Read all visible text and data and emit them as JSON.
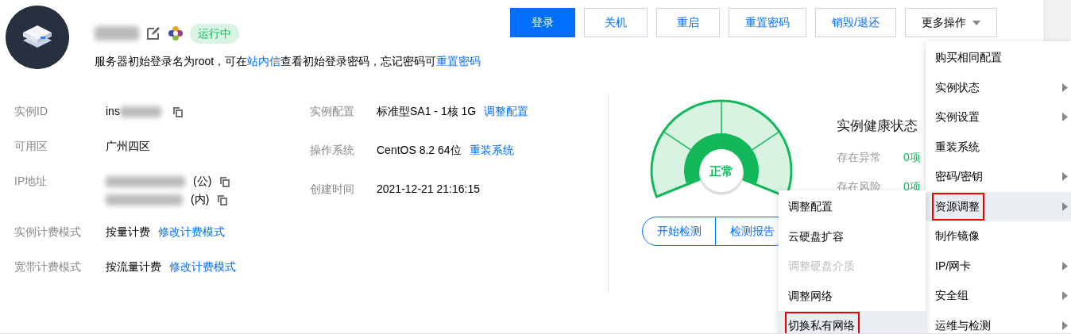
{
  "header": {
    "status": "运行中",
    "notice": [
      {
        "text": "服务器初始登录名为root，可在",
        "link": false
      },
      {
        "text": "站内信",
        "link": true
      },
      {
        "text": "查看初始登录密码，忘记密码可",
        "link": false
      },
      {
        "text": "重置密码",
        "link": true
      }
    ]
  },
  "actions": [
    {
      "label": "登录",
      "primary": true,
      "caret": false
    },
    {
      "label": "关机",
      "primary": false,
      "caret": false
    },
    {
      "label": "重启",
      "primary": false,
      "caret": false
    },
    {
      "label": "重置密码",
      "primary": false,
      "caret": false
    },
    {
      "label": "销毁/退还",
      "primary": false,
      "caret": false
    },
    {
      "label": "更多操作",
      "primary": false,
      "caret": true
    }
  ],
  "details_left": [
    {
      "label": "实例ID",
      "kind": "id",
      "value": "ins"
    },
    {
      "label": "可用区",
      "kind": "text",
      "value": "广州四区"
    },
    {
      "label": "IP地址",
      "kind": "ip",
      "addresses": [
        {
          "type": "(公)"
        },
        {
          "type": "(内)"
        }
      ]
    },
    {
      "label": "实例计费模式",
      "kind": "text",
      "value": "按量计费",
      "link": "修改计费模式"
    },
    {
      "label": "宽带计费模式",
      "kind": "text",
      "value": "按流量计费",
      "link": "修改计费模式"
    }
  ],
  "details_right": [
    {
      "label": "实例配置",
      "kind": "text",
      "value": "标准型SA1 - 1核 1G",
      "link": "调整配置"
    },
    {
      "label": "操作系统",
      "kind": "text",
      "value": "CentOS 8.2 64位",
      "link": "重装系统"
    },
    {
      "label": "创建时间",
      "kind": "text",
      "value": "2021-12-21 21:16:15"
    }
  ],
  "health": {
    "status": "正常",
    "title": "实例健康状态",
    "items": [
      {
        "label": "存在异常",
        "count": "0项"
      },
      {
        "label": "存在风险",
        "count": "0项"
      }
    ],
    "buttons": [
      "开始检测",
      "检测报告"
    ]
  },
  "more_menu": [
    {
      "label": "购买相同配置",
      "submenu": false,
      "selected": false,
      "outlined": false
    },
    {
      "label": "实例状态",
      "submenu": true,
      "selected": false,
      "outlined": false
    },
    {
      "label": "实例设置",
      "submenu": true,
      "selected": false,
      "outlined": false
    },
    {
      "label": "重装系统",
      "submenu": false,
      "selected": false,
      "outlined": false
    },
    {
      "label": "密码/密钥",
      "submenu": true,
      "selected": false,
      "outlined": false
    },
    {
      "label": "资源调整",
      "submenu": true,
      "selected": true,
      "outlined": true
    },
    {
      "label": "制作镜像",
      "submenu": false,
      "selected": false,
      "outlined": false
    },
    {
      "label": "IP/网卡",
      "submenu": true,
      "selected": false,
      "outlined": false
    },
    {
      "label": "安全组",
      "submenu": true,
      "selected": false,
      "outlined": false
    },
    {
      "label": "运维与检测",
      "submenu": true,
      "selected": false,
      "outlined": false
    }
  ],
  "sub_menu": [
    {
      "label": "调整配置",
      "disabled": false,
      "selected": false,
      "outlined": false
    },
    {
      "label": "云硬盘扩容",
      "disabled": false,
      "selected": false,
      "outlined": false
    },
    {
      "label": "调整硬盘介质",
      "disabled": true,
      "selected": false,
      "outlined": false
    },
    {
      "label": "调整网络",
      "disabled": false,
      "selected": false,
      "outlined": false
    },
    {
      "label": "切换私有网络",
      "disabled": false,
      "selected": true,
      "outlined": true
    }
  ]
}
